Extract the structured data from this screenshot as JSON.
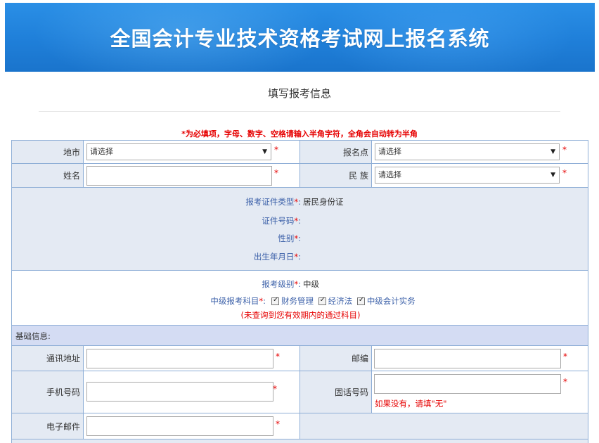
{
  "header": {
    "title": "全国会计专业技术资格考试网上报名系统"
  },
  "page": {
    "title": "填写报考信息",
    "notice": "*为必填项，字母、数字、空格请输入半角字符，全角会自动转为半角"
  },
  "form": {
    "city": {
      "label": "地市",
      "value": "请选择"
    },
    "site": {
      "label": "报名点",
      "value": "请选择"
    },
    "name": {
      "label": "姓名",
      "value": ""
    },
    "ethnicity": {
      "label": "民 族",
      "value": "请选择"
    },
    "id_type": {
      "label": "报考证件类型",
      "value": "居民身份证"
    },
    "id_number": {
      "label": "证件号码"
    },
    "gender": {
      "label": "性别"
    },
    "birth": {
      "label": "出生年月日"
    },
    "level": {
      "label": "报考级别",
      "value": "中级"
    },
    "subjects": {
      "label": "中级报考科目",
      "items": [
        "财务管理",
        "经济法",
        "中级会计实务"
      ],
      "note": "(未查询到您有效期内的通过科目)"
    },
    "section_basic": "基础信息:",
    "address": {
      "label": "通讯地址",
      "value": ""
    },
    "postcode": {
      "label": "邮编",
      "value": ""
    },
    "mobile": {
      "label": "手机号码",
      "value": ""
    },
    "landline": {
      "label": "固话号码",
      "value": "",
      "hint": "如果没有，请填\"无\""
    },
    "email": {
      "label": "电子邮件",
      "value": ""
    }
  },
  "symbols": {
    "required": "*",
    "colon": ":",
    "arrow": "▼"
  },
  "colors": {
    "banner": "#1f7fd9",
    "border": "#8eaed6",
    "label_bg": "#e4eaf3",
    "section_bg": "#d4dcf3",
    "required": "#e60000",
    "label_text": "#3a5fa8"
  }
}
